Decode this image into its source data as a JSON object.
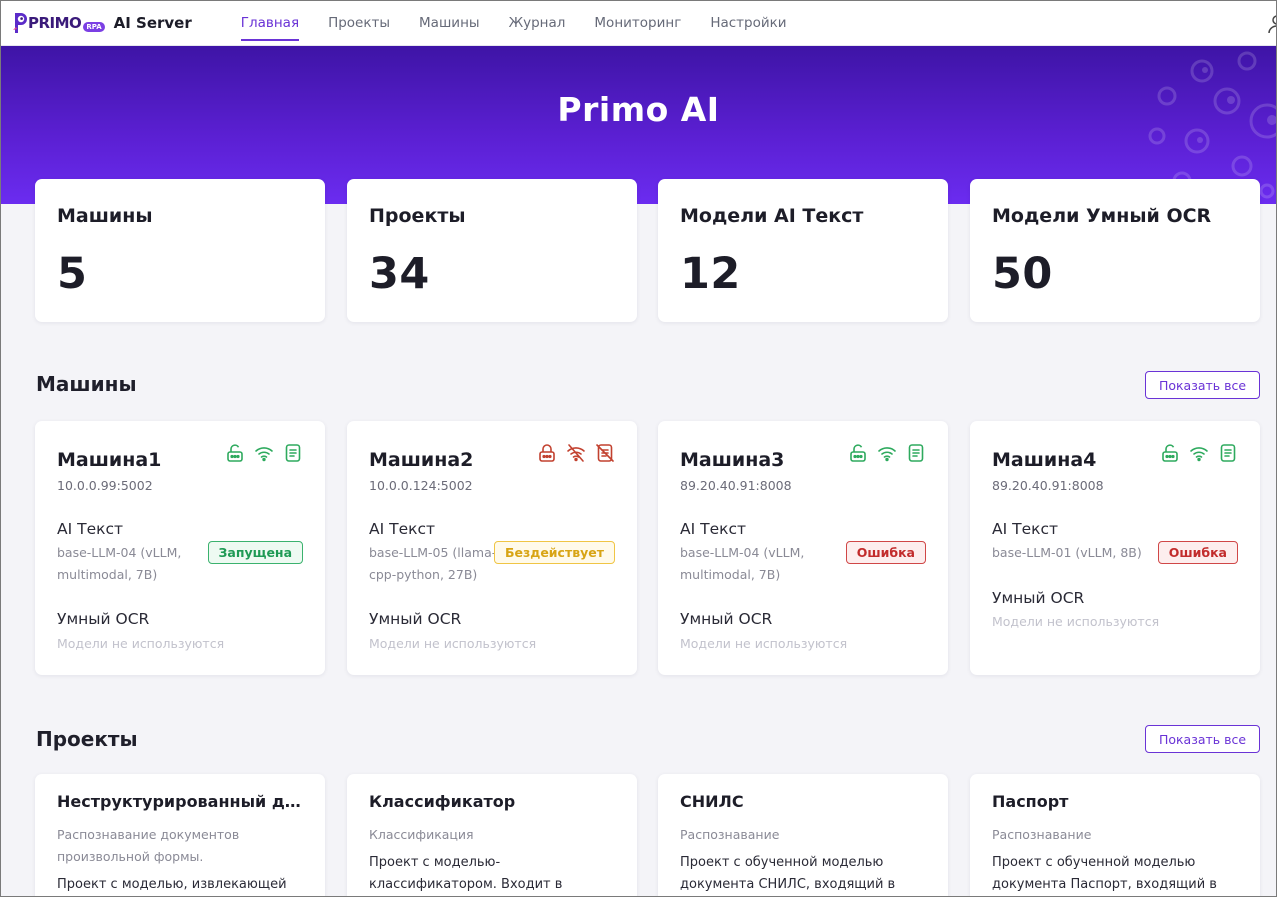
{
  "header": {
    "logo_text": "PRIMO",
    "logo_badge": "RPA",
    "app_title": "AI Server",
    "nav": [
      {
        "label": "Главная",
        "active": true
      },
      {
        "label": "Проекты",
        "active": false
      },
      {
        "label": "Машины",
        "active": false
      },
      {
        "label": "Журнал",
        "active": false
      },
      {
        "label": "Мониторинг",
        "active": false
      },
      {
        "label": "Настройки",
        "active": false
      }
    ]
  },
  "hero": {
    "title": "Primo AI"
  },
  "stats": [
    {
      "label": "Машины",
      "value": "5"
    },
    {
      "label": "Проекты",
      "value": "34"
    },
    {
      "label": "Модели AI Текст",
      "value": "12"
    },
    {
      "label": "Модели Умный OCR",
      "value": "50"
    }
  ],
  "machines_section": {
    "title": "Машины",
    "show_all": "Показать все",
    "items": [
      {
        "name": "Машина1",
        "address": "10.0.0.99:5002",
        "icons": [
          "lock-open-icon",
          "wifi-icon",
          "document-icon"
        ],
        "icon_color": "#2eaa5e",
        "ai_text_label": "AI Текст",
        "ai_text_model": "base-LLM-04 (vLLM, multimodal, 7B)",
        "status": "Запущена",
        "status_kind": "running",
        "ocr_label": "Умный OCR",
        "ocr_value": "Модели не используются"
      },
      {
        "name": "Машина2",
        "address": "10.0.0.124:5002",
        "icons": [
          "lock-closed-icon",
          "wifi-off-icon",
          "document-off-icon"
        ],
        "icon_color": "#c2412f",
        "ai_text_label": "AI Текст",
        "ai_text_model": "base-LLM-05 (llama-cpp-python, 27B)",
        "status": "Бездействует",
        "status_kind": "idle",
        "ocr_label": "Умный OCR",
        "ocr_value": "Модели не используются"
      },
      {
        "name": "Машина3",
        "address": "89.20.40.91:8008",
        "icons": [
          "lock-open-icon",
          "wifi-icon",
          "document-icon"
        ],
        "icon_color": "#2eaa5e",
        "ai_text_label": "AI Текст",
        "ai_text_model": "base-LLM-04 (vLLM, multimodal, 7B)",
        "status": "Ошибка",
        "status_kind": "error",
        "ocr_label": "Умный OCR",
        "ocr_value": "Модели не используются"
      },
      {
        "name": "Машина4",
        "address": "89.20.40.91:8008",
        "icons": [
          "lock-open-icon",
          "wifi-icon",
          "document-icon"
        ],
        "icon_color": "#2eaa5e",
        "ai_text_label": "AI Текст",
        "ai_text_model": "base-LLM-01 (vLLM, 8B)",
        "status": "Ошибка",
        "status_kind": "error",
        "ocr_label": "Умный OCR",
        "ocr_value": "Модели не используются"
      }
    ]
  },
  "projects_section": {
    "title": "Проекты",
    "show_all": "Показать все",
    "items": [
      {
        "name": "Неструктурированный документ",
        "category": "Распознавание документов произвольной формы.",
        "description": "Проект с моделью, извлекающей"
      },
      {
        "name": "Классификатор",
        "category": "Классификация",
        "description": "Проект с моделью-классификатором. Входит в"
      },
      {
        "name": "СНИЛС",
        "category": "Распознавание",
        "description": "Проект с обученной моделью документа СНИЛС, входящий в"
      },
      {
        "name": "Паспорт",
        "category": "Распознавание",
        "description": "Проект с обученной моделью документа Паспорт, входящий в"
      }
    ]
  },
  "colors": {
    "accent": "#6a33d6",
    "hero_start": "#3e14a6",
    "hero_end": "#6b2cf0",
    "ok": "#2eaa5e",
    "error": "#c2412f",
    "warning": "#d8a414"
  }
}
